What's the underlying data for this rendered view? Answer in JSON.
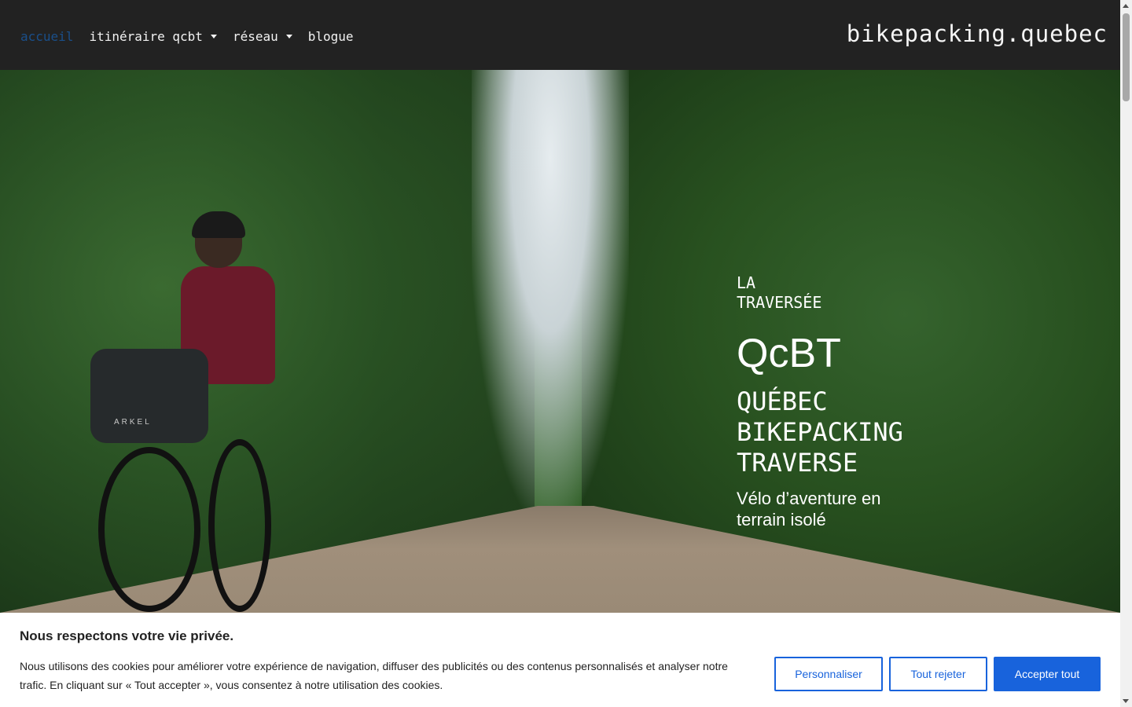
{
  "header": {
    "nav": [
      {
        "label": "accueil",
        "active": true,
        "has_dropdown": false
      },
      {
        "label": "itinéraire qcbt",
        "active": false,
        "has_dropdown": true
      },
      {
        "label": "réseau",
        "active": false,
        "has_dropdown": true
      },
      {
        "label": "blogue",
        "active": false,
        "has_dropdown": false
      }
    ],
    "brand": "bikepacking.quebec"
  },
  "hero": {
    "eyebrow": "LA TRAVERSÉE",
    "title": "QcBT",
    "subtitle": "QUÉBEC BIKEPACKING TRAVERSE",
    "tagline": "Vélo d’aventure en terrain isolé",
    "bag_brand": "ARKEL"
  },
  "cookie_banner": {
    "title": "Nous respectons votre vie privée.",
    "text": "Nous utilisons des cookies pour améliorer votre expérience de navigation, diffuser des publicités ou des contenus personnalisés et analyser notre trafic. En cliquant sur « Tout accepter », vous consentez à notre utilisation des cookies.",
    "buttons": {
      "customize": "Personnaliser",
      "reject": "Tout rejeter",
      "accept": "Accepter tout"
    }
  },
  "colors": {
    "header_bg": "#222222",
    "nav_active": "#1a4f8a",
    "accent_blue": "#1863dc"
  }
}
